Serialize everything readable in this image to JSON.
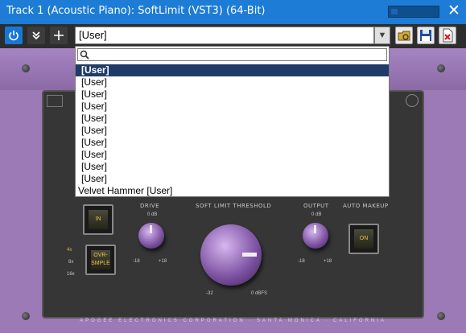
{
  "window": {
    "title": "Track 1 (Acoustic Piano): SoftLimit (VST3) (64-Bit)",
    "close_label": "✕",
    "level_meter": 0.15
  },
  "toolbar": {
    "power_icon": "power-icon",
    "expand_icon": "double-chevron-down-icon",
    "add_icon": "plus-icon",
    "add_label": "+",
    "expand_label": "»",
    "preset_value": "[User]",
    "preset_arrow": "▼",
    "icons": [
      "load-preset-icon",
      "save-preset-icon",
      "delete-preset-icon"
    ]
  },
  "dropdown": {
    "search_value": "",
    "items": [
      {
        "label": "[User]",
        "selected": true
      },
      {
        "label": "[User]",
        "selected": false
      },
      {
        "label": "[User]",
        "selected": false
      },
      {
        "label": "[User]",
        "selected": false
      },
      {
        "label": "[User]",
        "selected": false
      },
      {
        "label": "[User]",
        "selected": false
      },
      {
        "label": "[User]",
        "selected": false
      },
      {
        "label": "[User]",
        "selected": false
      },
      {
        "label": "[User]",
        "selected": false
      },
      {
        "label": "[User]",
        "selected": false
      },
      {
        "label": "Velvet Hammer [User]",
        "selected": false
      }
    ]
  },
  "plugin": {
    "labels": {
      "drive": "DRIVE",
      "threshold": "SOFT LIMIT THRESHOLD",
      "output": "OUTPUT",
      "auto_makeup": "AUTO MAKEUP"
    },
    "buttons": {
      "in": "IN",
      "oversample": "OVR-SMPLE",
      "on": "ON"
    },
    "oversample_rates": [
      "4x",
      "8x",
      "16x"
    ],
    "drive_ticks": {
      "top": "0 dB",
      "left": "-18",
      "right": "+18"
    },
    "output_ticks": {
      "top": "0 dB",
      "left": "-18",
      "right": "+18"
    },
    "threshold_ticks": {
      "left": "-32",
      "right": "0 dBFS"
    },
    "footer": "APOGEE ELECTRONICS CORPORATION · SANTA MONICA · CALIFORNIA",
    "accent_color": "#9b7ab6"
  }
}
